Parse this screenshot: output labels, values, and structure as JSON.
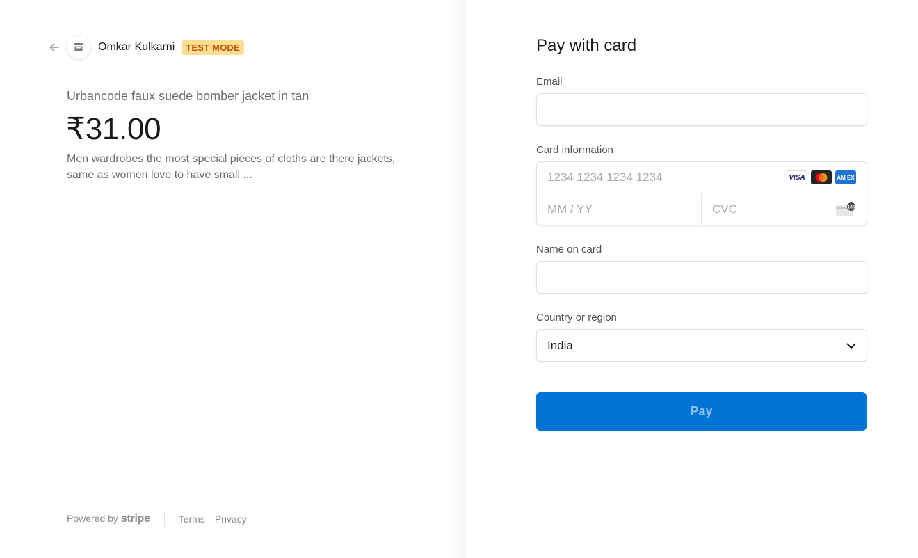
{
  "merchant": {
    "name": "Omkar Kulkarni",
    "badge": "TEST MODE",
    "icons": {
      "back": "arrow-left-icon",
      "avatar": "storefront-icon"
    }
  },
  "product": {
    "name": "Urbancode faux suede bomber jacket in tan",
    "price": "₹31.00",
    "description": "Men wardrobes the most special pieces of cloths are there jackets, same as women love to have small ..."
  },
  "footer": {
    "powered_by": "Powered by",
    "brand": "stripe",
    "links": [
      "Terms",
      "Privacy"
    ]
  },
  "form": {
    "title": "Pay with card",
    "email": {
      "label": "Email",
      "value": "",
      "placeholder": ""
    },
    "card": {
      "label": "Card information",
      "number_placeholder": "1234 1234 1234 1234",
      "expiry_placeholder": "MM / YY",
      "cvc_placeholder": "CVC",
      "brands": [
        "VISA",
        "Mastercard",
        "AMEX"
      ],
      "amex_text": "AM EX",
      "cvc_icon_text": "135"
    },
    "name": {
      "label": "Name on card",
      "value": ""
    },
    "country": {
      "label": "Country or region",
      "selected": "India"
    },
    "pay_button": "Pay"
  },
  "colors": {
    "accent": "#0074d4",
    "badge_bg": "#ffde92",
    "badge_text": "#bb5504"
  }
}
